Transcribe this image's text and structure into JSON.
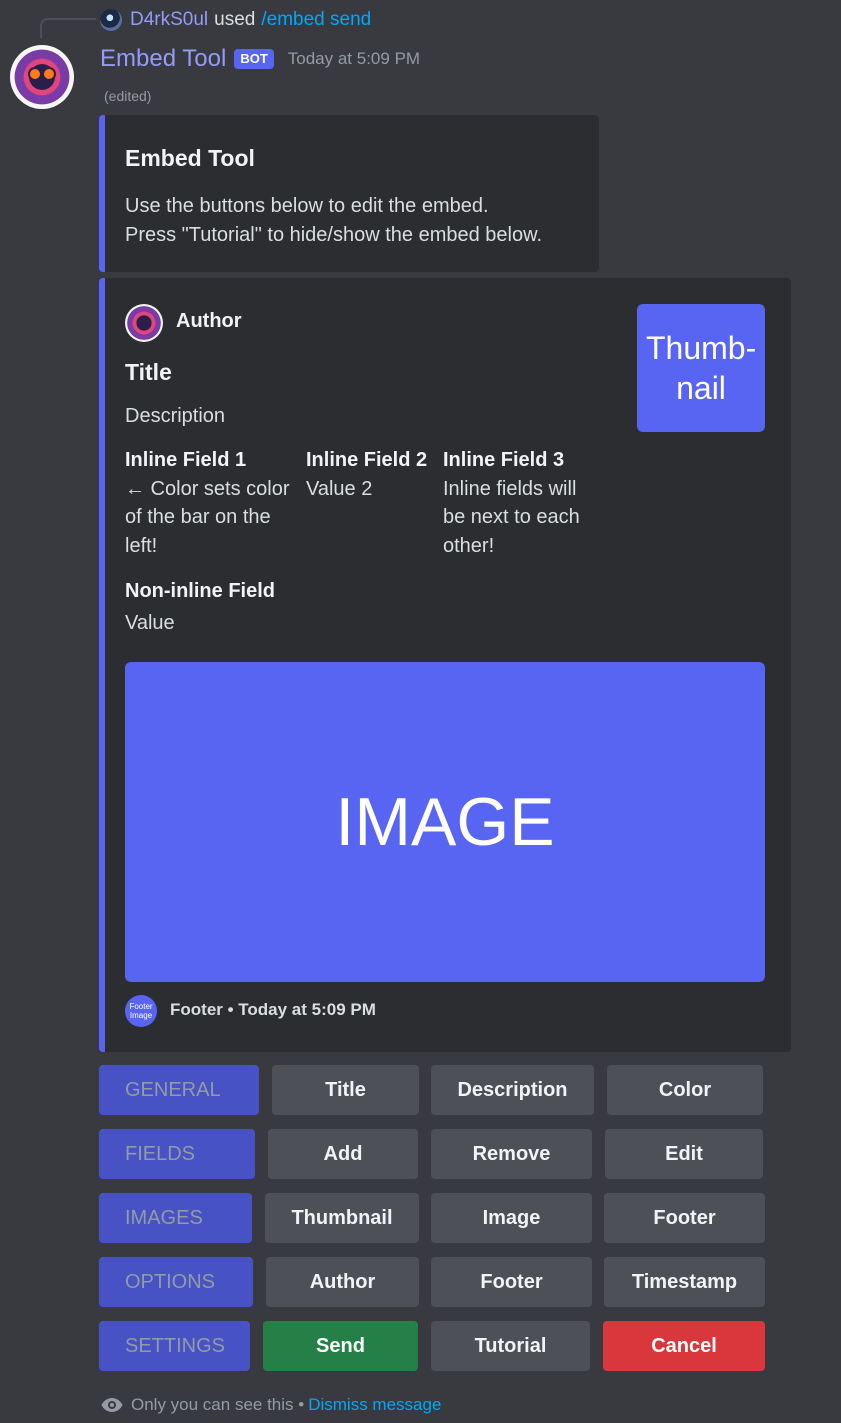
{
  "reply": {
    "user": "D4rkS0ul",
    "used": "used",
    "command": "/embed send"
  },
  "message": {
    "bot_name": "Embed Tool",
    "bot_tag": "BOT",
    "timestamp": "Today at 5:09 PM",
    "edited": "(edited)"
  },
  "tutorial_embed": {
    "title": "Embed Tool",
    "line1": "Use the buttons below to edit the embed.",
    "line2": "Press \"Tutorial\" to hide/show the embed below."
  },
  "preview_embed": {
    "author": "Author",
    "title": "Title",
    "description": "Description",
    "fields": [
      {
        "name": "Inline Field 1",
        "value": "← Color sets color of the bar on the left!"
      },
      {
        "name": "Inline Field 2",
        "value": "Value 2"
      },
      {
        "name": "Inline Field 3",
        "value": "Inline fields will be next to each other!"
      },
      {
        "name": "Non-inline Field",
        "value": "Value"
      }
    ],
    "thumbnail": "Thumb-nail",
    "image": "IMAGE",
    "footer_icon": "Footer Image",
    "footer": "Footer • Today at 5:09 PM",
    "bar_color": "#5865f2"
  },
  "button_rows": [
    {
      "category": "GENERAL",
      "buttons": [
        "Title",
        "Description",
        "Color"
      ]
    },
    {
      "category": "FIELDS",
      "buttons": [
        "Add",
        "Remove",
        "Edit"
      ]
    },
    {
      "category": "IMAGES",
      "buttons": [
        "Thumbnail",
        "Image",
        "Footer"
      ]
    },
    {
      "category": "OPTIONS",
      "buttons": [
        "Author",
        "Footer",
        "Timestamp"
      ]
    },
    {
      "category": "SETTINGS",
      "buttons": [
        "Send",
        "Tutorial",
        "Cancel"
      ]
    }
  ],
  "ephemeral": {
    "notice": "Only you can see this •",
    "dismiss": "Dismiss message"
  },
  "icons": {
    "visibility": "eye-icon"
  }
}
